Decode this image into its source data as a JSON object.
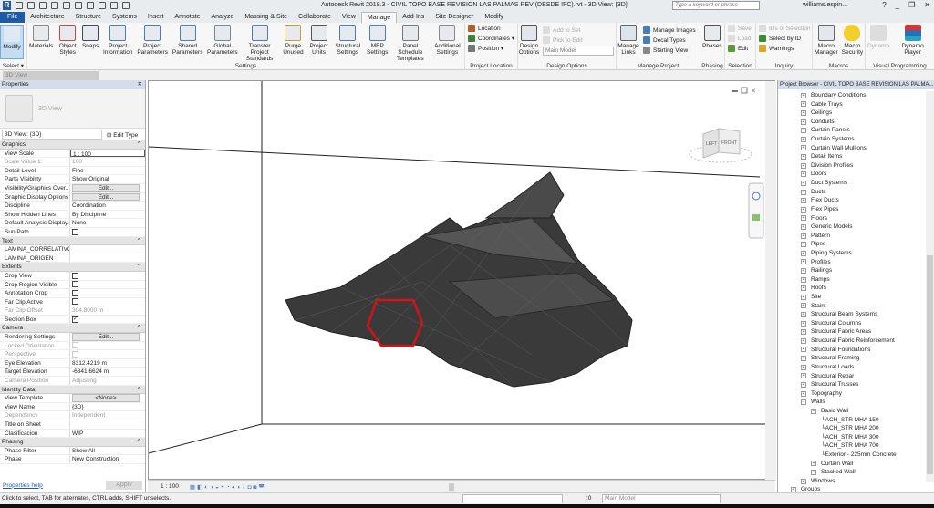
{
  "title": "Autodesk Revit 2018.3 -    CIVIL TOPO BASE REVISION LAS PALMAS REV (DESDE IFC).rvt - 3D View: {3D}",
  "search_placeholder": "Type a keyword or phrase",
  "user": "williams.espin...",
  "tabs": [
    "File",
    "Architecture",
    "Structure",
    "Systems",
    "Insert",
    "Annotate",
    "Analyze",
    "Massing & Site",
    "Collaborate",
    "View",
    "Manage",
    "Add-Ins",
    "Site Designer",
    "Modify"
  ],
  "active_tab": "Manage",
  "ribbon": {
    "select": {
      "modify": "Modify",
      "label": "Select ▾"
    },
    "settings": {
      "label": "Settings",
      "buttons": [
        "Materials",
        "Object Styles",
        "Snaps",
        "Project Information",
        "Project Parameters",
        "Shared Parameters",
        "Global Parameters",
        "Transfer Project Standards",
        "Purge Unused",
        "Project Units",
        "Structural Settings",
        "MEP Settings",
        "Panel Schedule Templates",
        "Additional Settings"
      ]
    },
    "location": {
      "label": "Project Location",
      "items": [
        "Location",
        "Coordinates ▾",
        "Position ▾"
      ]
    },
    "design": {
      "label": "Design Options",
      "button": "Design Options",
      "items": [
        "Add to Set",
        "Pick to Edit"
      ],
      "combo": "Main Model"
    },
    "manage_project": {
      "label": "Manage Project",
      "button": "Manage Links",
      "items": [
        "Manage Images",
        "Decal Types",
        "Starting View"
      ]
    },
    "phasing": {
      "label": "Phasing",
      "button": "Phases"
    },
    "selection": {
      "label": "Selection",
      "items": [
        "Save",
        "Load",
        "Edit"
      ]
    },
    "inquiry": {
      "label": "Inquiry",
      "items": [
        "IDs of Selection",
        "Select by ID",
        "Warnings"
      ]
    },
    "macros": {
      "label": "Macros",
      "buttons": [
        "Macro Manager",
        "Macro Security"
      ]
    },
    "visual": {
      "label": "Visual Programming",
      "buttons": [
        "Dynamo",
        "Dynamo Player"
      ]
    }
  },
  "view_tab": "3D View",
  "properties": {
    "title": "Properties",
    "type_name": "3D View",
    "selector": "3D View: {3D}",
    "edit_type": "Edit Type",
    "groups": [
      {
        "name": "Graphics",
        "rows": [
          [
            "View Scale",
            "1 : 100",
            "input"
          ],
          [
            "Scale Value    1:",
            "100",
            "gray"
          ],
          [
            "Detail Level",
            "Fine"
          ],
          [
            "Parts Visibility",
            "Show Original"
          ],
          [
            "Visibility/Graphics Over...",
            "Edit...",
            "btn"
          ],
          [
            "Graphic Display Options",
            "Edit...",
            "btn"
          ],
          [
            "Discipline",
            "Coordination"
          ],
          [
            "Show Hidden Lines",
            "By Discipline"
          ],
          [
            "Default Analysis Display...",
            "None"
          ],
          [
            "Sun Path",
            "",
            "cb"
          ]
        ]
      },
      {
        "name": "Text",
        "rows": [
          [
            "LAMINA_CORRELATIVO",
            ""
          ],
          [
            "LAMINA_ORIGEN",
            ""
          ]
        ]
      },
      {
        "name": "Extents",
        "rows": [
          [
            "Crop View",
            "",
            "cb"
          ],
          [
            "Crop Region Visible",
            "",
            "cb"
          ],
          [
            "Annotation Crop",
            "",
            "cb"
          ],
          [
            "Far Clip Active",
            "",
            "cb"
          ],
          [
            "Far Clip Offset",
            "304.8000 m",
            "gray"
          ],
          [
            "Section Box",
            "✓",
            "cb"
          ]
        ]
      },
      {
        "name": "Camera",
        "rows": [
          [
            "Rendering Settings",
            "Edit...",
            "btn"
          ],
          [
            "Locked Orientation",
            "",
            "graycb"
          ],
          [
            "Perspective",
            "",
            "graycb"
          ],
          [
            "Eye Elevation",
            "8312.4219 m"
          ],
          [
            "Target Elevation",
            "-6341.6624 m"
          ],
          [
            "Camera Position",
            "Adjusting",
            "gray"
          ]
        ]
      },
      {
        "name": "Identity Data",
        "rows": [
          [
            "View Template",
            "<None>",
            "btn"
          ],
          [
            "View Name",
            "{3D}"
          ],
          [
            "Dependency",
            "Independent",
            "gray"
          ],
          [
            "Title on Sheet",
            ""
          ],
          [
            "Clasificacion",
            "WIP"
          ]
        ]
      },
      {
        "name": "Phasing",
        "rows": [
          [
            "Phase Filter",
            "Show All"
          ],
          [
            "Phase",
            "New Construction"
          ]
        ]
      }
    ],
    "help": "Properties help",
    "apply": "Apply"
  },
  "viewcube": {
    "left": "LEFT",
    "front": "FRONT"
  },
  "view_scale": "1 : 100",
  "browser": {
    "title": "Project Browser - CIVIL TOPO BASE REVISION LAS PALMA...",
    "items": [
      {
        "l": "Boundary Conditions",
        "d": 1
      },
      {
        "l": "Cable Trays",
        "d": 1
      },
      {
        "l": "Ceilings",
        "d": 1
      },
      {
        "l": "Conduits",
        "d": 1
      },
      {
        "l": "Curtain Panels",
        "d": 1
      },
      {
        "l": "Curtain Systems",
        "d": 1
      },
      {
        "l": "Curtain Wall Mullions",
        "d": 1
      },
      {
        "l": "Detail Items",
        "d": 1
      },
      {
        "l": "Division Profiles",
        "d": 1
      },
      {
        "l": "Doors",
        "d": 1
      },
      {
        "l": "Duct Systems",
        "d": 1
      },
      {
        "l": "Ducts",
        "d": 1
      },
      {
        "l": "Flex Ducts",
        "d": 1
      },
      {
        "l": "Flex Pipes",
        "d": 1
      },
      {
        "l": "Floors",
        "d": 1
      },
      {
        "l": "Generic Models",
        "d": 1
      },
      {
        "l": "Pattern",
        "d": 1
      },
      {
        "l": "Pipes",
        "d": 1
      },
      {
        "l": "Piping Systems",
        "d": 1
      },
      {
        "l": "Profiles",
        "d": 1
      },
      {
        "l": "Railings",
        "d": 1
      },
      {
        "l": "Ramps",
        "d": 1
      },
      {
        "l": "Roofs",
        "d": 1
      },
      {
        "l": "Site",
        "d": 1
      },
      {
        "l": "Stairs",
        "d": 1
      },
      {
        "l": "Structural Beam Systems",
        "d": 1
      },
      {
        "l": "Structural Columns",
        "d": 1
      },
      {
        "l": "Structural Fabric Areas",
        "d": 1
      },
      {
        "l": "Structural Fabric Reinforcement",
        "d": 1
      },
      {
        "l": "Structural Foundations",
        "d": 1
      },
      {
        "l": "Structural Framing",
        "d": 1
      },
      {
        "l": "Structural Loads",
        "d": 1
      },
      {
        "l": "Structural Rebar",
        "d": 1
      },
      {
        "l": "Structural Trusses",
        "d": 1
      },
      {
        "l": "Topography",
        "d": 1
      },
      {
        "l": "Walls",
        "d": 1,
        "open": true
      },
      {
        "l": "Basic Wall",
        "d": 2,
        "open": true
      },
      {
        "l": "ACH_STR MHA 150",
        "d": 3,
        "leaf": true
      },
      {
        "l": "ACH_STR MHA 200",
        "d": 3,
        "leaf": true
      },
      {
        "l": "ACH_STR MHA 300",
        "d": 3,
        "leaf": true
      },
      {
        "l": "ACH_STR MHA 700",
        "d": 3,
        "leaf": true
      },
      {
        "l": "Exterior - 225mm Concrete",
        "d": 3,
        "leaf": true
      },
      {
        "l": "Curtain Wall",
        "d": 2
      },
      {
        "l": "Stacked Wall",
        "d": 2
      },
      {
        "l": "Windows",
        "d": 1
      },
      {
        "l": "Groups",
        "d": 0
      }
    ]
  },
  "status": {
    "text": "Click to select, TAB for alternates, CTRL adds, SHIFT unselects.",
    "count": ":0",
    "model": "Main Model"
  },
  "colors": {
    "accent": "#1d5aa8",
    "selection": "#d0141a",
    "mesh": "#3a3a3a"
  }
}
